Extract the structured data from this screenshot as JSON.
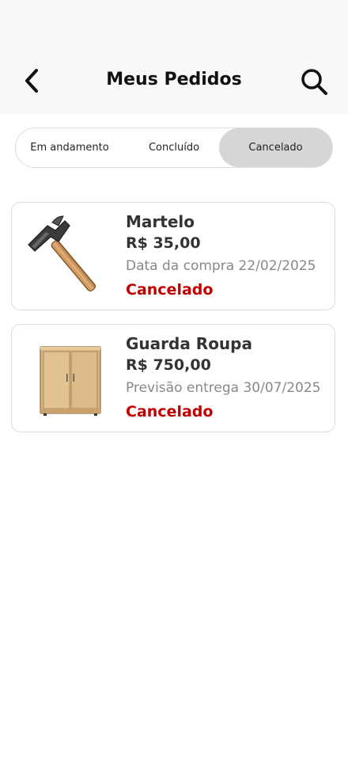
{
  "header": {
    "title": "Meus Pedidos",
    "back_icon": "chevron-left-icon",
    "search_icon": "search-icon"
  },
  "tabs": [
    {
      "label": "Em andamento",
      "selected": false
    },
    {
      "label": "Concluído",
      "selected": false
    },
    {
      "label": "Cancelado",
      "selected": true
    }
  ],
  "orders": [
    {
      "name": "Martelo",
      "price": "R$ 35,00",
      "date_text": "Data da compra 22/02/2025",
      "status": "Cancelado",
      "image": "hammer-image"
    },
    {
      "name": "Guarda Roupa",
      "price": "R$ 750,00",
      "date_text": "Previsão entrega 30/07/2025",
      "status": "Cancelado",
      "image": "wardrobe-image"
    }
  ],
  "colors": {
    "status_cancelled": "#c00000",
    "selected_tab": "#d6d6d6",
    "header_bg": "#f8f8f8"
  }
}
